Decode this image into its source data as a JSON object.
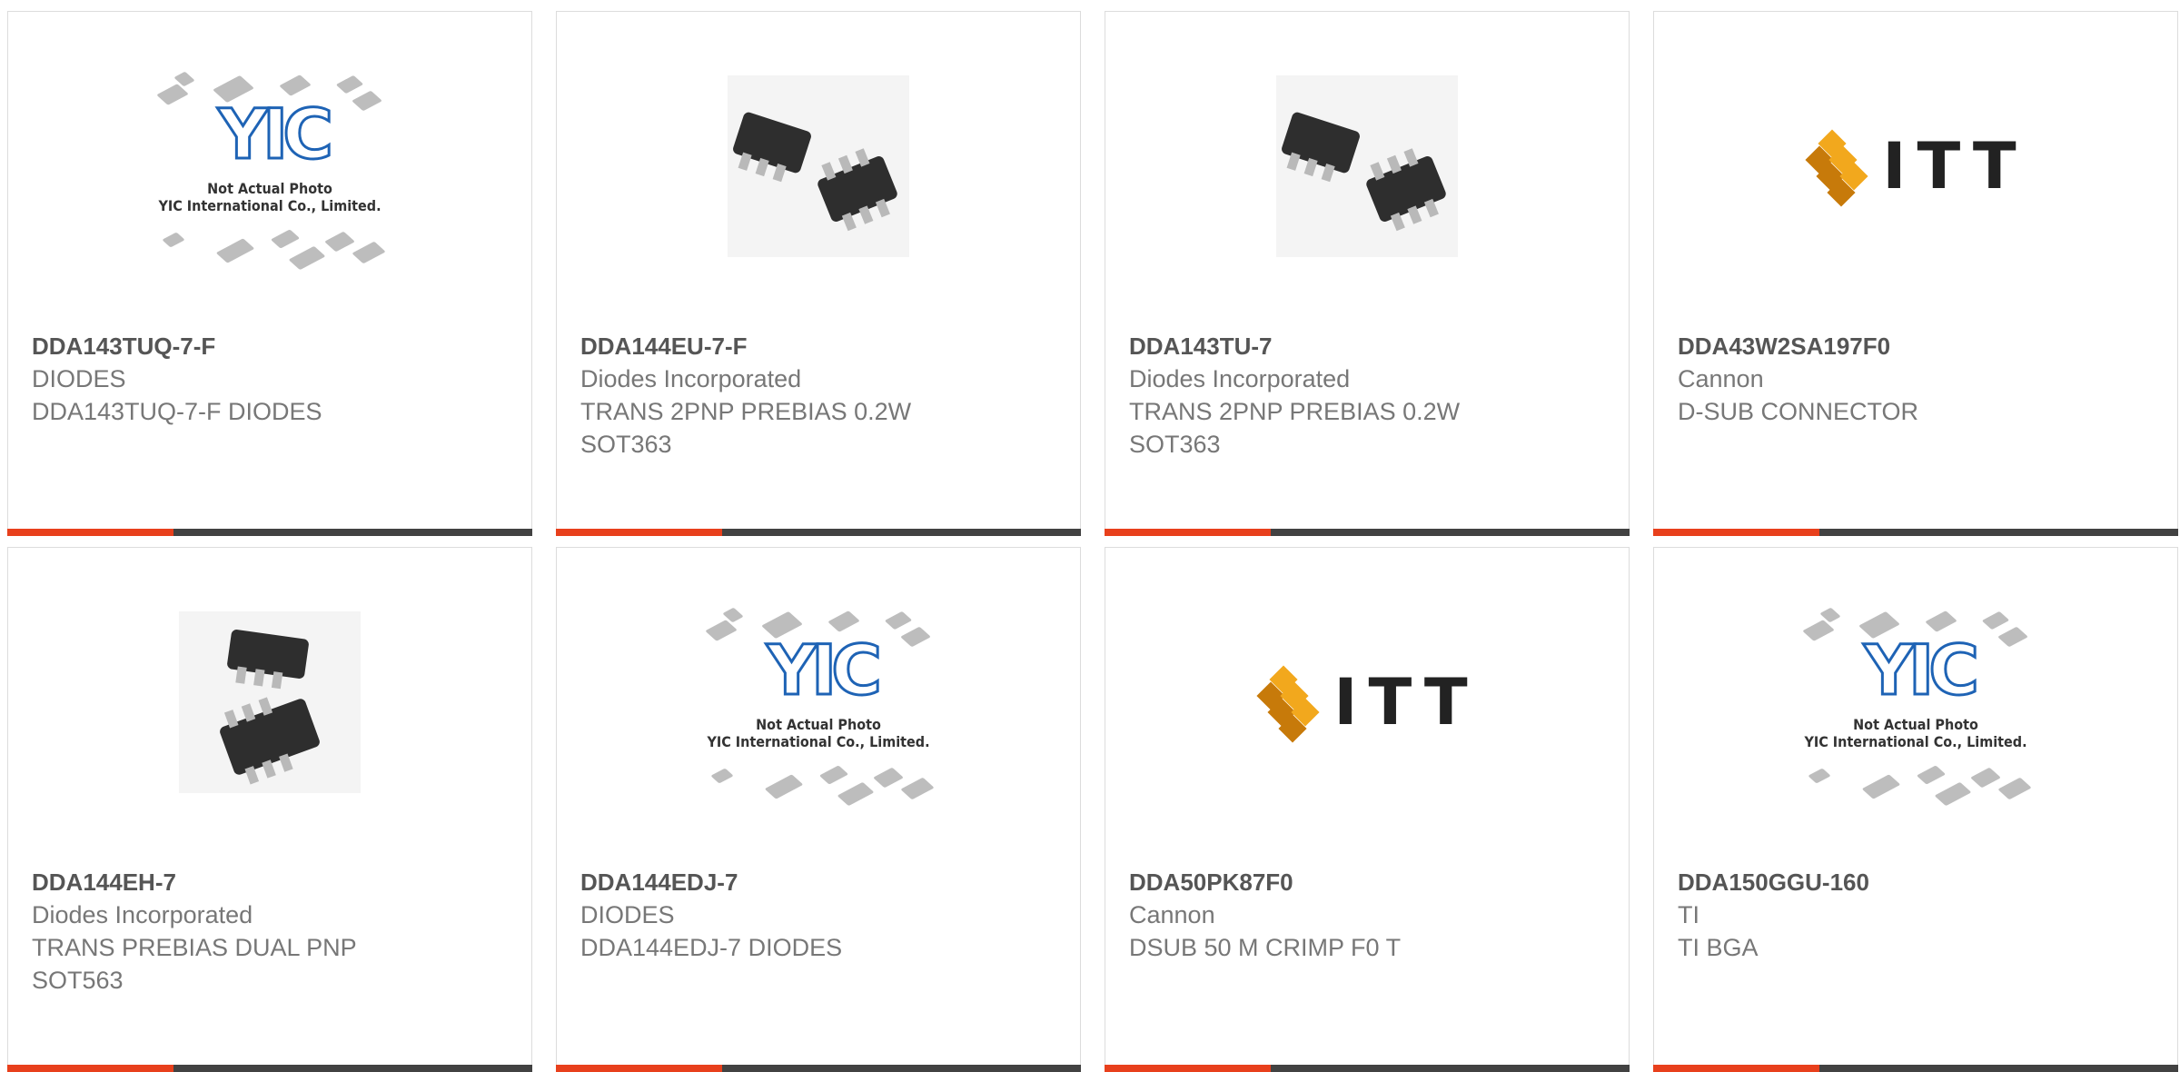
{
  "colors": {
    "accent": "#e8401c",
    "bar": "#424242",
    "border": "#dcdcdc"
  },
  "placeholder_photo": {
    "line1": "Not Actual Photo",
    "line2": "YIC International Co., Limited."
  },
  "itt_logo_text": "ITT",
  "products": [
    {
      "part_number": "DDA143TUQ-7-F",
      "manufacturer": "DIODES",
      "description_lines": [
        "DDA143TUQ-7-F DIODES"
      ],
      "image": "placeholder"
    },
    {
      "part_number": "DDA144EU-7-F",
      "manufacturer": "Diodes Incorporated",
      "description_lines": [
        "TRANS 2PNP PREBIAS 0.2W",
        "SOT363"
      ],
      "image": "sot363"
    },
    {
      "part_number": "DDA143TU-7",
      "manufacturer": "Diodes Incorporated",
      "description_lines": [
        "TRANS 2PNP PREBIAS 0.2W",
        "SOT363"
      ],
      "image": "sot363"
    },
    {
      "part_number": "DDA43W2SA197F0",
      "manufacturer": "Cannon",
      "description_lines": [
        "D-SUB CONNECTOR"
      ],
      "image": "itt"
    },
    {
      "part_number": "DDA144EH-7",
      "manufacturer": "Diodes Incorporated",
      "description_lines": [
        "TRANS PREBIAS DUAL PNP",
        "SOT563"
      ],
      "image": "sot563"
    },
    {
      "part_number": "DDA144EDJ-7",
      "manufacturer": "DIODES",
      "description_lines": [
        "DDA144EDJ-7 DIODES"
      ],
      "image": "placeholder"
    },
    {
      "part_number": "DDA50PK87F0",
      "manufacturer": "Cannon",
      "description_lines": [
        "DSUB 50 M CRIMP F0 T"
      ],
      "image": "itt"
    },
    {
      "part_number": "DDA150GGU-160",
      "manufacturer": "TI",
      "description_lines": [
        "TI BGA"
      ],
      "image": "placeholder"
    }
  ]
}
